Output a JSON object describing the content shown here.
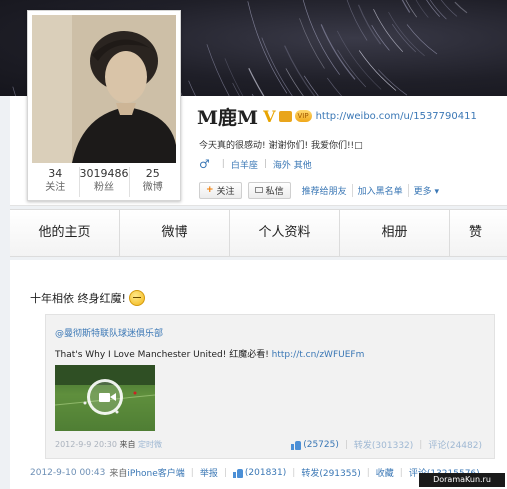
{
  "profile": {
    "nickname": "M鹿M",
    "v_badge": "V",
    "vip_badge": "VIP",
    "home_url": "http://weibo.com/u/1537790411",
    "bio": "今天真的很感动! 谢谢你们! 我爱你们!!□",
    "gender_icon": "♂",
    "constellation": "白羊座",
    "location": "海外 其他",
    "stats": [
      {
        "num": "34",
        "label": "关注"
      },
      {
        "num": "3019486",
        "label": "粉丝"
      },
      {
        "num": "25",
        "label": "微博"
      }
    ]
  },
  "actions": {
    "follow_label": "关注",
    "message_label": "私信",
    "recommend_label": "推荐给朋友",
    "blacklist_label": "加入黑名单",
    "more_label": "更多 ▾"
  },
  "tabs": [
    "他的主页",
    "微博",
    "个人资料",
    "相册",
    "赞"
  ],
  "post": {
    "text": "十年相依 终身红魔!",
    "emoji_icon": "smile-face-icon",
    "repost": {
      "author": "@曼彻斯特联队球迷俱乐部",
      "content": "That's Why I Love Manchester United! 红魔必看! ",
      "content_url": "http://t.cn/zWFUEFm",
      "time": "2012-9-9 20:30",
      "from": "来自",
      "source": "定时微",
      "likes": "(25725)",
      "reposts": "转发(301332)",
      "comments": "评论(24482)"
    },
    "time": "2012-9-10 00:43",
    "from": "来自",
    "source": "iPhone客户端",
    "report": "举报",
    "likes": "(201831)",
    "reposts": "转发(291355)",
    "favorite": "收藏",
    "comments": "评论(13215576)"
  },
  "watermark": "DoramaKun.ru"
}
